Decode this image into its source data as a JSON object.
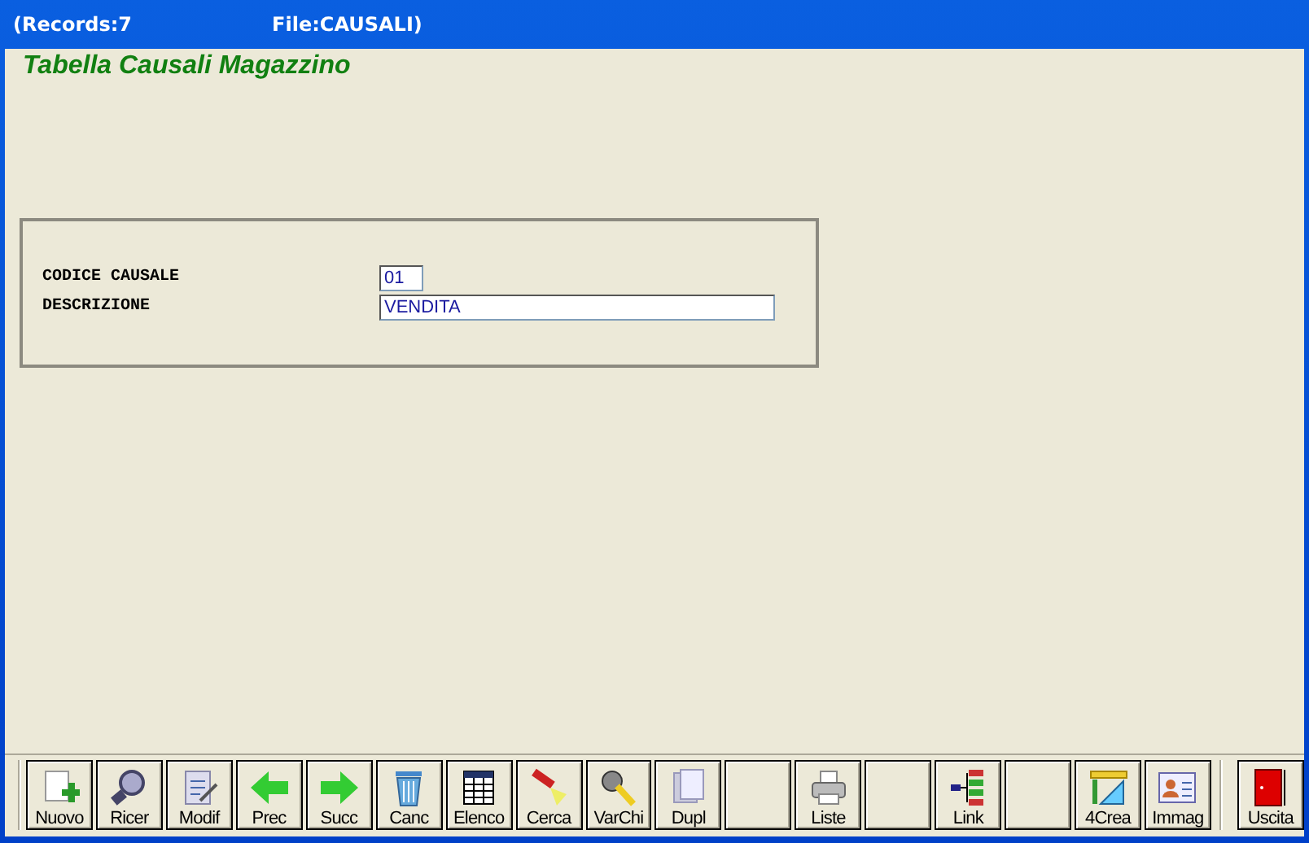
{
  "window": {
    "records": "(Records:7",
    "file": "File:CAUSALI)"
  },
  "heading": "Tabella Causali Magazzino",
  "form": {
    "fields": [
      {
        "label": "CODICE CAUSALE",
        "value": "01",
        "kind": "short"
      },
      {
        "label": "DESCRIZIONE",
        "value": "VENDITA",
        "kind": "long"
      }
    ]
  },
  "toolbar": [
    {
      "label": "Nuovo",
      "kind": "command"
    },
    {
      "label": "Ricer",
      "kind": "command"
    },
    {
      "label": "Modif",
      "kind": "command"
    },
    {
      "label": "Prec",
      "kind": "command"
    },
    {
      "label": "Succ",
      "kind": "command"
    },
    {
      "label": "Canc",
      "kind": "command"
    },
    {
      "label": "Elenco",
      "kind": "command"
    },
    {
      "label": "Cerca",
      "kind": "command"
    },
    {
      "label": "VarChi",
      "kind": "command"
    },
    {
      "label": "Dupl",
      "kind": "command"
    },
    {
      "kind": "blank"
    },
    {
      "label": "Liste",
      "kind": "command"
    },
    {
      "kind": "blank"
    },
    {
      "label": "Link",
      "kind": "command"
    },
    {
      "kind": "blank"
    },
    {
      "label": "4Crea",
      "kind": "command"
    },
    {
      "label": "Immag",
      "kind": "command"
    },
    {
      "label": "Uscita",
      "kind": "exit"
    }
  ]
}
